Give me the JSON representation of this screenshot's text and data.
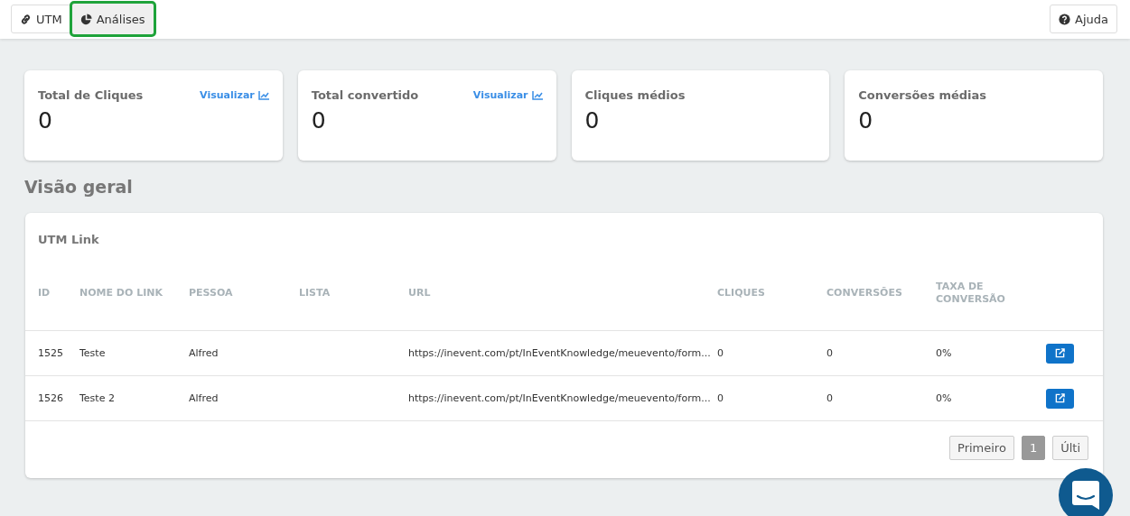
{
  "tabs": [
    {
      "label": "UTM",
      "selected": false
    },
    {
      "label": "Análises",
      "selected": true
    }
  ],
  "help_button": "Ajuda",
  "stats": [
    {
      "title": "Total de Cliques",
      "value": "0",
      "link": "Visualizar"
    },
    {
      "title": "Total convertido",
      "value": "0",
      "link": "Visualizar"
    },
    {
      "title": "Cliques médios",
      "value": "0"
    },
    {
      "title": "Conversões médias",
      "value": "0"
    }
  ],
  "section_title": "Visão geral",
  "table": {
    "title": "UTM Link",
    "columns": [
      "ID",
      "NOME DO LINK",
      "PESSOA",
      "LISTA",
      "URL",
      "CLIQUES",
      "CONVERSÕES",
      "TAXA DE CONVERSÃO"
    ],
    "rows": [
      [
        "1525",
        "Teste",
        "Alfred",
        "",
        "https://inevent.com/pt/InEventKnowledge/meuevento/form...",
        "0",
        "0",
        "0%"
      ],
      [
        "1526",
        "Teste 2",
        "Alfred",
        "",
        "https://inevent.com/pt/InEventKnowledge/meuevento/form...",
        "0",
        "0",
        "0%"
      ]
    ]
  },
  "pagination": [
    {
      "label": "Primeiro",
      "selected": false
    },
    {
      "label": "1",
      "selected": true
    },
    {
      "label": "Últi",
      "selected": false
    }
  ]
}
